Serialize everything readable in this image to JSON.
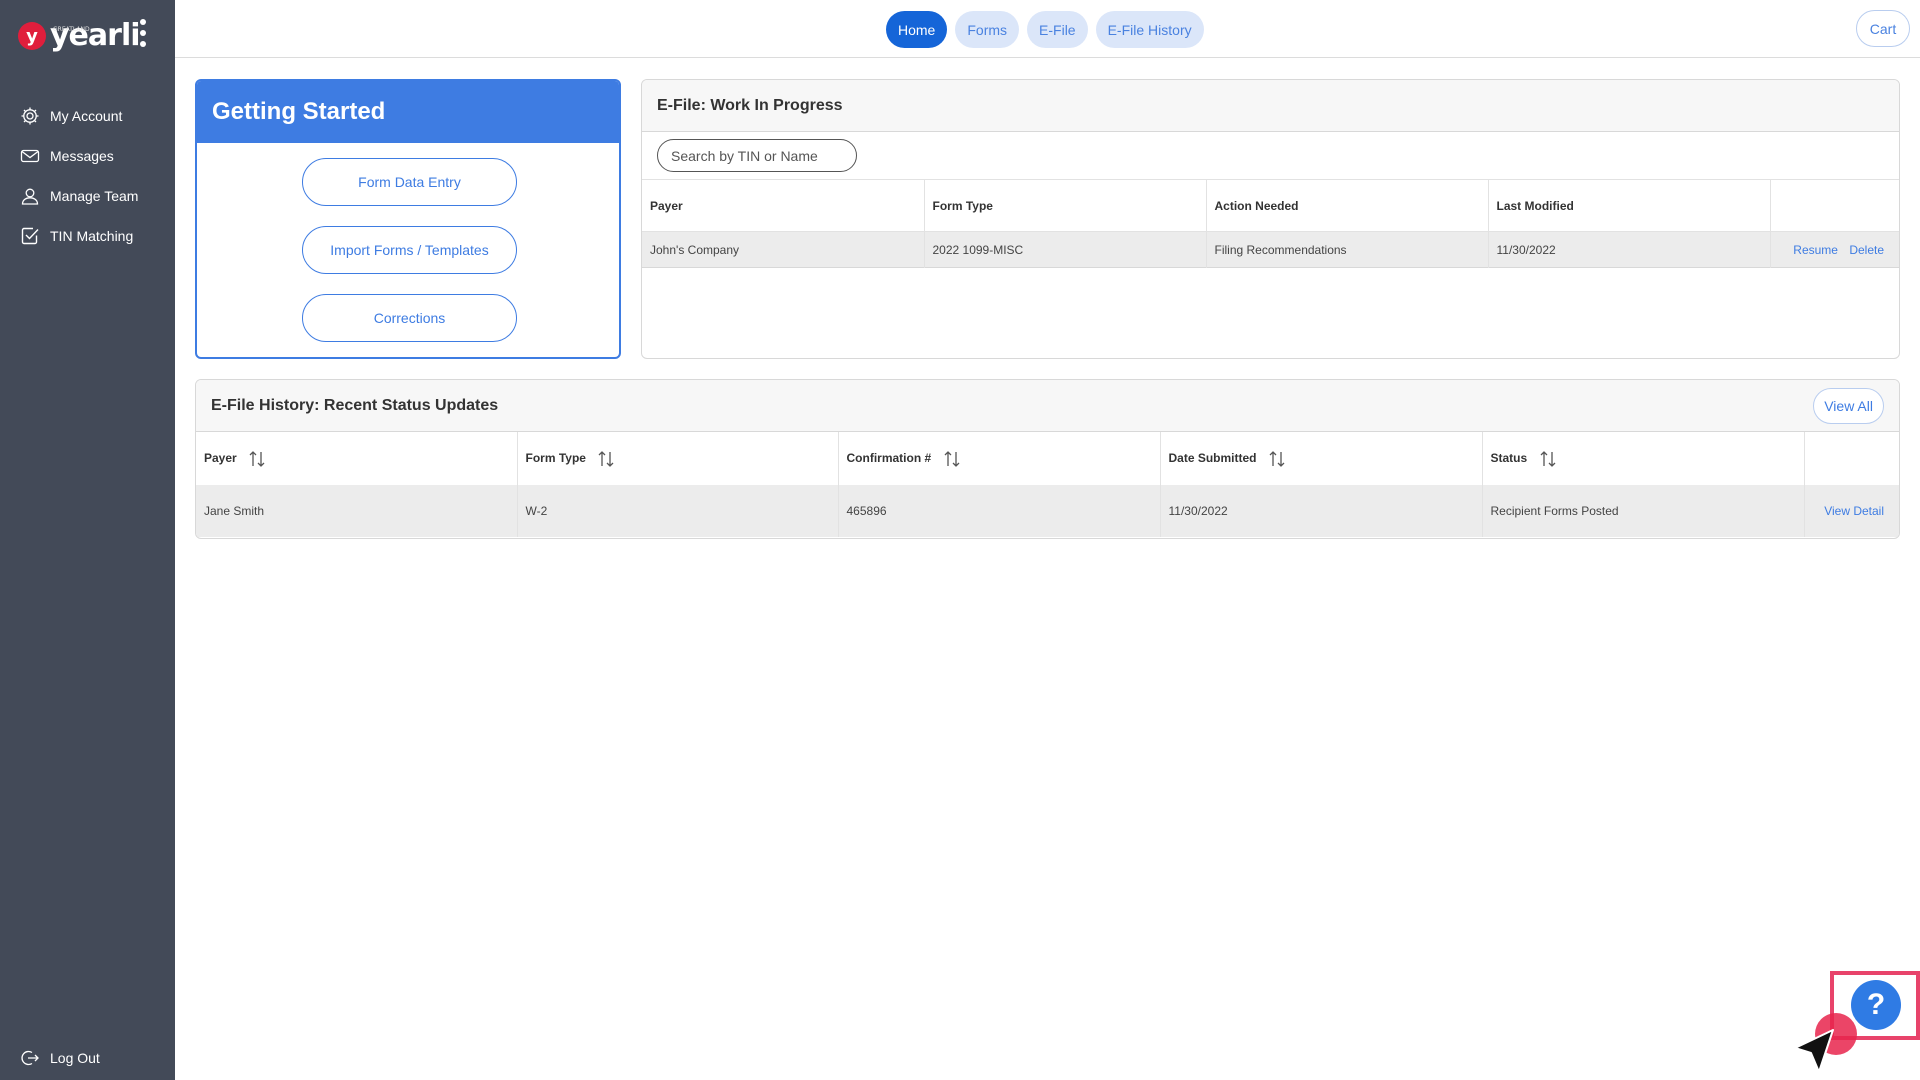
{
  "brand": {
    "mark": "y",
    "name": "yearli",
    "sub": "GREATLAND"
  },
  "sidebar": {
    "items": [
      {
        "label": "My Account",
        "icon": "gear-icon"
      },
      {
        "label": "Messages",
        "icon": "envelope-icon"
      },
      {
        "label": "Manage Team",
        "icon": "user-icon"
      },
      {
        "label": "TIN Matching",
        "icon": "check-square-icon"
      }
    ],
    "logout": "Log Out"
  },
  "topnav": {
    "tabs": [
      "Home",
      "Forms",
      "E-File",
      "E-File History"
    ],
    "active": "Home",
    "cart": "Cart"
  },
  "getting_started": {
    "title": "Getting Started",
    "buttons": [
      "Form Data Entry",
      "Import Forms / Templates",
      "Corrections"
    ]
  },
  "wip": {
    "title": "E-File: Work In Progress",
    "search_placeholder": "Search by TIN or Name",
    "columns": [
      "Payer",
      "Form Type",
      "Action Needed",
      "Last Modified"
    ],
    "rows": [
      {
        "payer": "John's Company",
        "form_type": "2022 1099-MISC",
        "action": "Filing Recommendations",
        "modified": "11/30/2022",
        "resume": "Resume",
        "delete": "Delete"
      }
    ]
  },
  "history": {
    "title": "E-File History: Recent Status Updates",
    "view_all": "View All",
    "columns": [
      "Payer",
      "Form Type",
      "Confirmation #",
      "Date Submitted",
      "Status"
    ],
    "rows": [
      {
        "payer": "Jane Smith",
        "form_type": "W-2",
        "confirmation": "465896",
        "date": "11/30/2022",
        "status": "Recipient Forms Posted",
        "action": "View Detail"
      }
    ]
  },
  "help": {
    "label": "?"
  },
  "colors": {
    "sidebar": "#434a58",
    "primary": "#3e7ce2",
    "active_tab": "#1565d8",
    "highlight": "#e8436b"
  }
}
